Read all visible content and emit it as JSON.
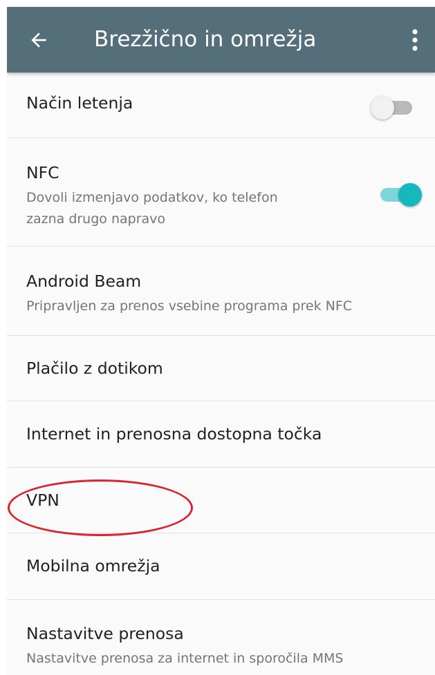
{
  "appbar": {
    "title": "Brezžično in omrežja",
    "back_icon": "arrow-left-icon",
    "more_icon": "more-vertical-icon",
    "color": "#546e7a"
  },
  "settings": {
    "airplane": {
      "title": "Način letenja",
      "enabled": false
    },
    "nfc": {
      "title": "NFC",
      "summary_line1": "Dovoli izmenjavo podatkov, ko telefon",
      "summary_line2": "zazna drugo napravo",
      "enabled": true
    },
    "android_beam": {
      "title": "Android Beam",
      "summary": "Pripravljen za prenos vsebine programa prek NFC"
    },
    "tap_pay": {
      "title": "Plačilo z dotikom"
    },
    "hotspot": {
      "title": "Internet in prenosna dostopna točka"
    },
    "vpn": {
      "title": "VPN"
    },
    "mobile_networks": {
      "title": "Mobilna omrežja"
    },
    "transfer_settings": {
      "title": "Nastavitve prenosa",
      "summary": "Nastavitve prenosa za internet in sporočila MMS"
    }
  },
  "colors": {
    "accent": "#17b8bc",
    "accent_track": "#7fd6d8",
    "switch_off_thumb": "#f1f1f1",
    "switch_off_track": "#b9b9b9",
    "highlight": "#d9242f"
  }
}
